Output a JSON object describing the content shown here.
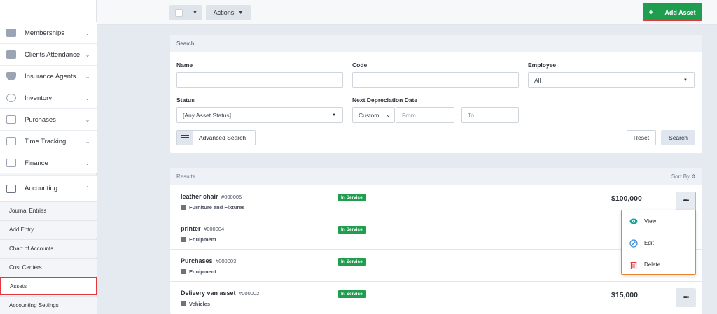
{
  "sidebar": {
    "items": [
      {
        "label": "Memberships"
      },
      {
        "label": "Clients Attendance"
      },
      {
        "label": "Insurance Agents"
      },
      {
        "label": "Inventory"
      },
      {
        "label": "Purchases"
      },
      {
        "label": "Time Tracking"
      },
      {
        "label": "Finance"
      },
      {
        "label": "Accounting"
      }
    ],
    "subitems": [
      {
        "label": "Journal Entries"
      },
      {
        "label": "Add Entry"
      },
      {
        "label": "Chart of Accounts"
      },
      {
        "label": "Cost Centers"
      },
      {
        "label": "Assets"
      },
      {
        "label": "Accounting Settings"
      }
    ]
  },
  "toolbar": {
    "actions_label": "Actions",
    "add_asset_label": "Add Asset",
    "add_icon": "+"
  },
  "search": {
    "heading": "Search",
    "name_label": "Name",
    "name_value": "",
    "code_label": "Code",
    "code_value": "",
    "employee_label": "Employee",
    "employee_value": "All",
    "status_label": "Status",
    "status_value": "[Any Asset Status]",
    "date_label": "Next Depreciation Date",
    "date_mode": "Custom",
    "date_from_placeholder": "From",
    "date_sep": "-",
    "date_to_placeholder": "To",
    "advanced_label": "Advanced Search",
    "reset_label": "Reset",
    "search_label": "Search"
  },
  "results": {
    "heading": "Results",
    "sort_label": "Sort By",
    "rows": [
      {
        "name": "leather chair",
        "code": "#000005",
        "category": "Furniture and Fixtures",
        "status": "In Service",
        "amount": "$100,000"
      },
      {
        "name": "printer",
        "code": "#000004",
        "category": "Equipment",
        "status": "In Service",
        "amount": ""
      },
      {
        "name": "Purchases",
        "code": "#000003",
        "category": "Equipment",
        "status": "In Service",
        "amount": ""
      },
      {
        "name": "Delivery van asset",
        "code": "#000002",
        "category": "Vehicles",
        "status": "In Service",
        "amount": "$15,000"
      }
    ],
    "more_label": "•••"
  },
  "row_menu": {
    "items": [
      {
        "label": "View",
        "icon": "eye-icon"
      },
      {
        "label": "Edit",
        "icon": "edit-icon"
      },
      {
        "label": "Delete",
        "icon": "trash-icon"
      }
    ]
  },
  "colors": {
    "primary_green": "#1f9e4f",
    "highlight_red": "#e4383f",
    "menu_orange": "#e98430",
    "view_teal": "#1aa39a",
    "edit_blue": "#3a8fd8",
    "delete_red": "#e4383f"
  }
}
